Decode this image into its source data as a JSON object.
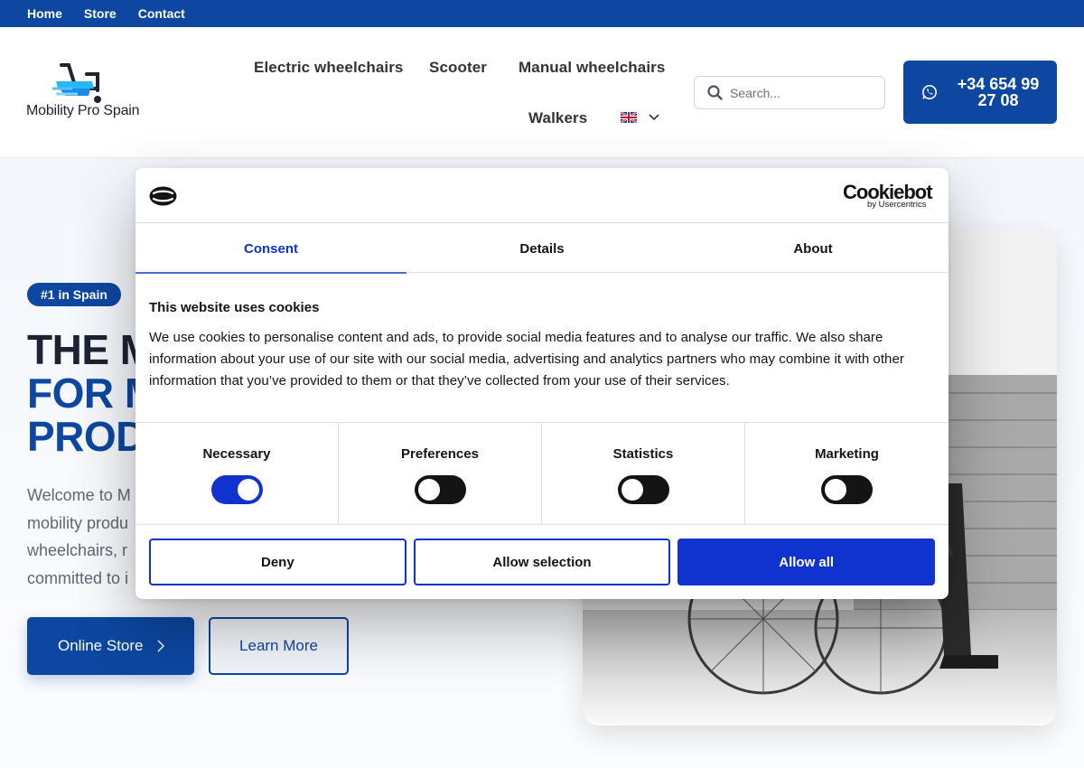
{
  "topbar": {
    "links": [
      "Home",
      "Store",
      "Contact"
    ]
  },
  "header": {
    "logo_text": "Mobility Pro Spain",
    "nav": [
      "Electric wheelchairs",
      "Scooter",
      "Manual wheelchairs",
      "Walkers"
    ],
    "search_placeholder": "Search...",
    "phone_line1": "+34 654 99",
    "phone_line2": "27 08"
  },
  "hero": {
    "badge": "#1 in Spain",
    "title_line1": "THE M",
    "title_line2": "FOR M",
    "title_line3": "PROD",
    "text_lines": [
      "Welcome to M",
      "mobility produ",
      "wheelchairs, r",
      "committed to i"
    ],
    "store_button": "Online Store",
    "learn_button": "Learn More"
  },
  "cookie": {
    "brand": "Cookiebot",
    "brand_sub": "by Usercentrics",
    "tabs": [
      "Consent",
      "Details",
      "About"
    ],
    "heading": "This website uses cookies",
    "body": "We use cookies to personalise content and ads, to provide social media features and to analyse our traffic. We also share information about your use of our site with our social media, advertising and analytics partners who may combine it with other information that you’ve provided to them or that they’ve collected from your use of their services.",
    "categories": [
      {
        "label": "Necessary",
        "enabled": true
      },
      {
        "label": "Preferences",
        "enabled": false
      },
      {
        "label": "Statistics",
        "enabled": false
      },
      {
        "label": "Marketing",
        "enabled": false
      }
    ],
    "buttons": {
      "deny": "Deny",
      "allow_selection": "Allow selection",
      "allow_all": "Allow all"
    }
  },
  "colors": {
    "brand_blue": "#0d47a1",
    "cookiebot_blue": "#1032cf"
  }
}
